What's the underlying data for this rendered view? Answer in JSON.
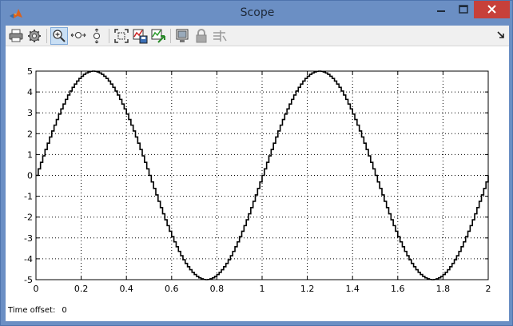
{
  "window": {
    "title": "Scope",
    "titlebar_color": "#6b8fc4",
    "close_color": "#c7403a"
  },
  "toolbar": {
    "buttons": [
      {
        "icon": "print-icon"
      },
      {
        "icon": "parameters-gear-icon"
      },
      {
        "icon": "zoom-in-icon",
        "active": true
      },
      {
        "icon": "zoom-x-axis-icon"
      },
      {
        "icon": "zoom-y-axis-icon"
      },
      {
        "icon": "autoscale-icon"
      },
      {
        "icon": "save-axes-settings-icon"
      },
      {
        "icon": "restore-axes-settings-icon"
      },
      {
        "icon": "floating-scope-icon"
      },
      {
        "icon": "lock-axes-icon"
      },
      {
        "icon": "signal-selection-icon"
      }
    ],
    "overflow_icon": "toolbar-overflow-arrow-icon"
  },
  "status": {
    "label": "Time offset:",
    "value": "0"
  },
  "chart_data": {
    "type": "line",
    "style": "step",
    "series": [
      {
        "function": "5*sin(2*pi*t)",
        "amplitude": 5,
        "frequency_hz": 1,
        "sample_time": 0.01,
        "color": "#000000"
      }
    ],
    "xlim": [
      0,
      2
    ],
    "ylim": [
      -5,
      5
    ],
    "xticks": [
      "0",
      "0.2",
      "0.4",
      "0.6",
      "0.8",
      "1",
      "1.2",
      "1.4",
      "1.6",
      "1.8",
      "2"
    ],
    "yticks": [
      "5",
      "4",
      "3",
      "2",
      "1",
      "0",
      "-1",
      "-2",
      "-3",
      "-4",
      "-5"
    ],
    "grid": true,
    "grid_style": "dotted",
    "title": "",
    "xlabel": "",
    "ylabel": ""
  }
}
